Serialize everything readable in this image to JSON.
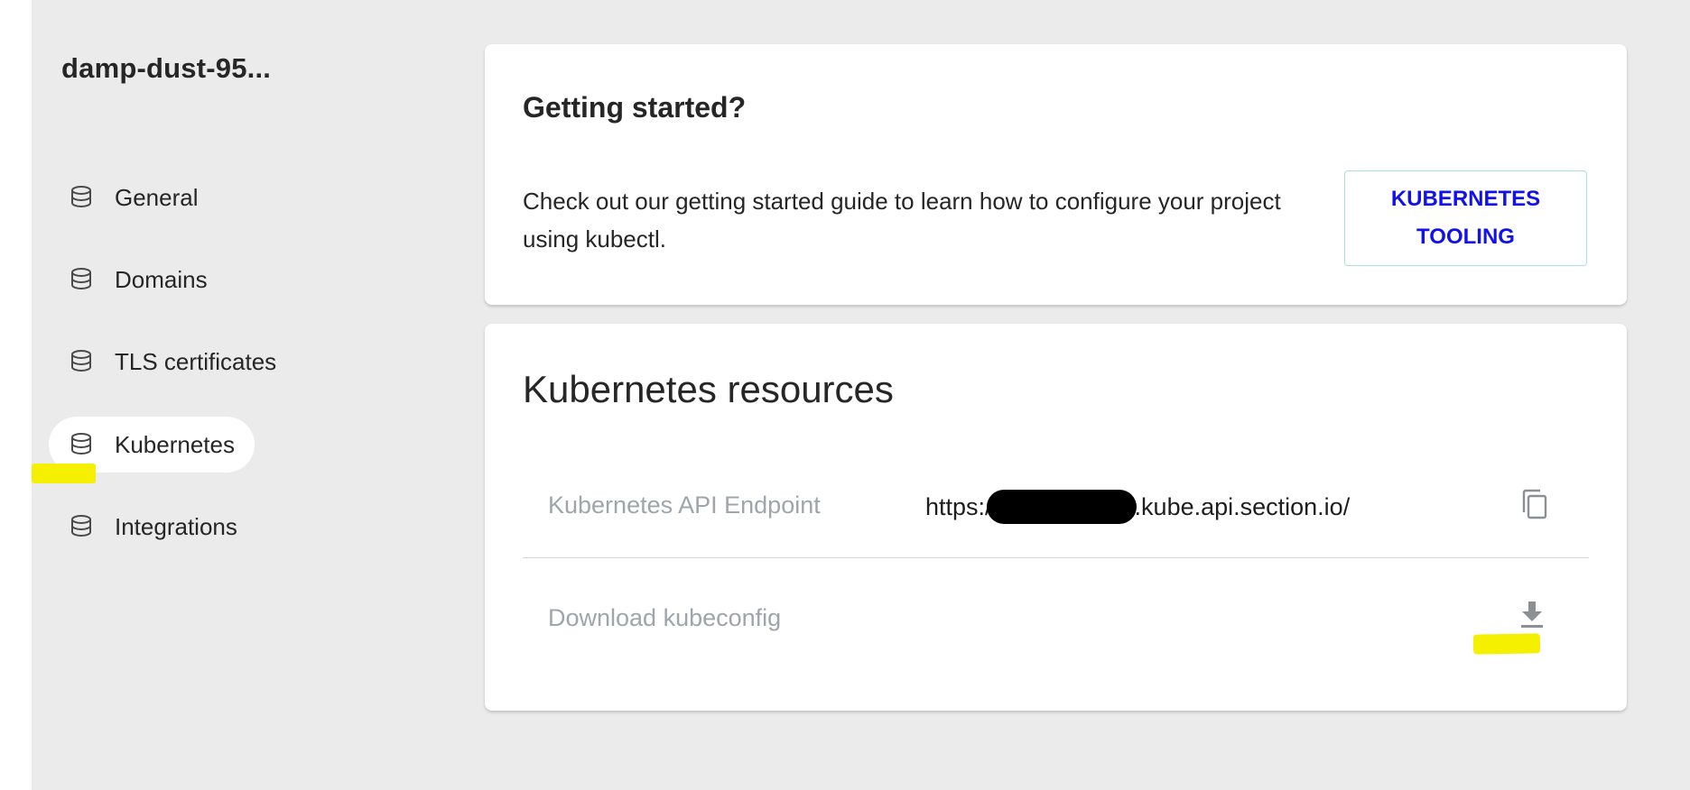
{
  "sidebar": {
    "project_name": "damp-dust-95...",
    "items": [
      {
        "label": "General",
        "icon": "layers-icon",
        "active": false
      },
      {
        "label": "Domains",
        "icon": "layers-icon",
        "active": false
      },
      {
        "label": "TLS certificates",
        "icon": "layers-icon",
        "active": false
      },
      {
        "label": "Kubernetes",
        "icon": "layers-icon",
        "active": true
      },
      {
        "label": "Integrations",
        "icon": "layers-icon",
        "active": false
      }
    ]
  },
  "getting_started": {
    "title": "Getting started?",
    "description": "Check out our getting started guide to learn how to configure your project using kubectl.",
    "button_label": "KUBERNETES TOOLING"
  },
  "resources": {
    "title": "Kubernetes resources",
    "endpoint": {
      "label": "Kubernetes API Endpoint",
      "value_prefix": "https:/",
      "value_suffix": ".kube.api.section.io/",
      "action_icon": "copy-icon"
    },
    "kubeconfig": {
      "label": "Download kubeconfig",
      "action_icon": "download-icon"
    }
  },
  "colors": {
    "background": "#ebebeb",
    "card": "#ffffff",
    "accent_link": "#1212e8",
    "button_border": "#a8e3d8",
    "muted_text": "#a0a4ab",
    "annotation_highlight": "#f5ef00"
  }
}
